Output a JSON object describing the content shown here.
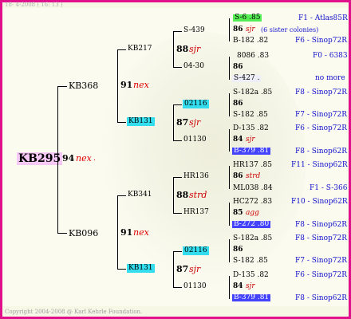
{
  "header": {
    "date": "18- 4-2008 ( 16: 13 )"
  },
  "footer": {
    "copyright": "Copyright 2004-2008 @ Karl Kehrle Foundation."
  },
  "root": {
    "id": "KB295",
    "num": "94",
    "tag": "nex",
    "tag_dot": "."
  },
  "gen1": [
    {
      "id": "KB368",
      "num": "91",
      "tag": "nex"
    },
    {
      "id": "KB096",
      "num": "91",
      "tag": "nex"
    }
  ],
  "gen2": [
    {
      "id": "KB217",
      "num": "88",
      "tag": "sjr"
    },
    {
      "id": "KB131",
      "num": "87",
      "tag": "sjr"
    },
    {
      "id": "KB341",
      "num": "88",
      "tag": "strd"
    },
    {
      "id": "KB131",
      "num": "87",
      "tag": "sjr"
    }
  ],
  "gen3": [
    "S-439",
    "04-30",
    "02116",
    "01130",
    "HR136",
    "HR137",
    "02116",
    "01130"
  ],
  "gen4": [
    {
      "sire": "S-6 .85",
      "sire_ref": "F1 - Atlas85R",
      "num": "86",
      "tag": "sjr",
      "note": "(6 sister colonies)",
      "dam": "B-182 .82",
      "dam_ref": "F6 - Sinop72R"
    },
    {
      "sire": "8086 .83",
      "sire_ref": "F0 - 6383",
      "num": "86",
      "tag": "",
      "note": "",
      "dam": "S-427 .",
      "dam_ref": "no more"
    },
    {
      "sire": "S-182a .85",
      "sire_ref": "F8 - Sinop72R",
      "num": "86",
      "tag": "",
      "note": "",
      "dam": "S-182 .85",
      "dam_ref": "F7 - Sinop72R"
    },
    {
      "sire": "D-135 .82",
      "sire_ref": "F6 - Sinop72R",
      "num": "84",
      "tag": "sjr",
      "note": "",
      "dam": "B-379 .81",
      "dam_ref": "F8 - Sinop62R"
    },
    {
      "sire": "HR137 .85",
      "sire_ref": "F11 - Sinop62R",
      "num": "86",
      "tag": "strd",
      "note": "",
      "dam": "ML038 .84",
      "dam_ref": "F1 - S-366"
    },
    {
      "sire": "HC272 .83",
      "sire_ref": "F10 - Sinop62R",
      "num": "85",
      "tag": "agg",
      "note": "",
      "dam": "B-272 .80",
      "dam_ref": "F8 - Sinop62R"
    },
    {
      "sire": "S-182a .85",
      "sire_ref": "F8 - Sinop72R",
      "num": "86",
      "tag": "",
      "note": "",
      "dam": "S-182 .85",
      "dam_ref": "F7 - Sinop72R"
    },
    {
      "sire": "D-135 .82",
      "sire_ref": "F6 - Sinop72R",
      "num": "84",
      "tag": "sjr",
      "note": "",
      "dam": "B-379 .81",
      "dam_ref": "F8 - Sinop62R"
    }
  ]
}
